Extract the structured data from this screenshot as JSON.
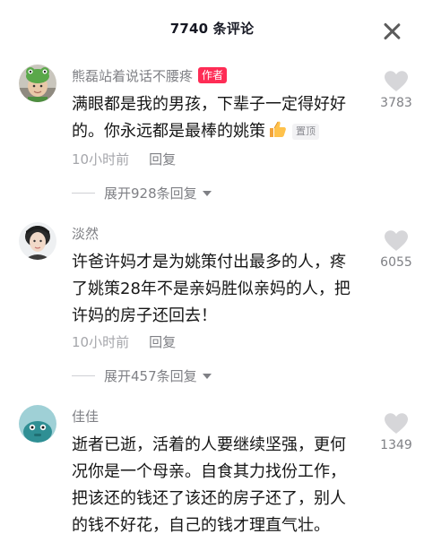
{
  "header": {
    "title": "7740 条评论"
  },
  "comments": [
    {
      "username": "熊磊站着说话不腰疼",
      "author_tag": "作者",
      "text": "满眼都是我的男孩，下辈子一定得好好的。你永远都是最棒的姚策",
      "emoji": "thumbs-up-icon",
      "pin_tag": "置顶",
      "time": "10小时前",
      "reply_label": "回复",
      "like_count": "3783",
      "expand_label": "展开928条回复"
    },
    {
      "username": "淡然",
      "text": "许爸许妈才是为姚策付出最多的人，疼了姚策28年不是亲妈胜似亲妈的人，把许妈的房子还回去！",
      "time": "10小时前",
      "reply_label": "回复",
      "like_count": "6055",
      "expand_label": "展开457条回复"
    },
    {
      "username": "佳佳",
      "text": "逝者已逝，活着的人要继续坚强，更何况你是一个母亲。自食其力找份工作，把该还的钱还了该还的房子还了，别人的钱不好花，自己的钱才理直气壮。",
      "like_count": "1349"
    }
  ],
  "colors": {
    "author_tag": "#fe2c55",
    "secondary_text": "#7f8085",
    "heart": "#d6d6d9"
  }
}
